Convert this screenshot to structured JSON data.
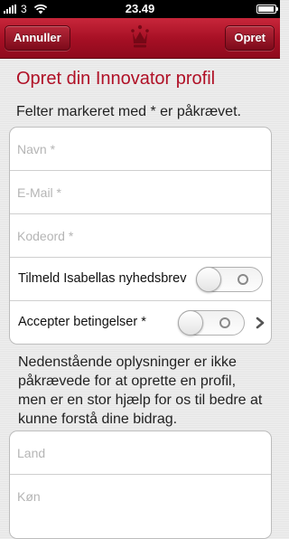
{
  "status_bar": {
    "carrier": "3",
    "time": "23.49"
  },
  "nav": {
    "cancel_label": "Annuller",
    "create_label": "Opret"
  },
  "form": {
    "title": "Opret din Innovator profil",
    "required_note": "Felter markeret med * er påkrævet.",
    "name_placeholder": "Navn *",
    "email_placeholder": "E-Mail *",
    "password_placeholder": "Kodeord *",
    "newsletter_label": "Tilmeld Isabellas nyhedsbrev",
    "newsletter_on": false,
    "terms_label": "Accepter betingelser *",
    "terms_on": false,
    "optional_note": "Nedenstående oplysninger er ikke påkrævede for at oprette en profil, men er en stor hjælp for os til bedre at kunne forstå dine bidrag.",
    "country_placeholder": "Land",
    "gender_placeholder": "Køn"
  },
  "colors": {
    "accent": "#b01026",
    "navbar": "#a50f24"
  },
  "icons": [
    "signal-icon",
    "wifi-icon",
    "battery-icon",
    "crown-logo-icon",
    "chevron-right-icon"
  ]
}
